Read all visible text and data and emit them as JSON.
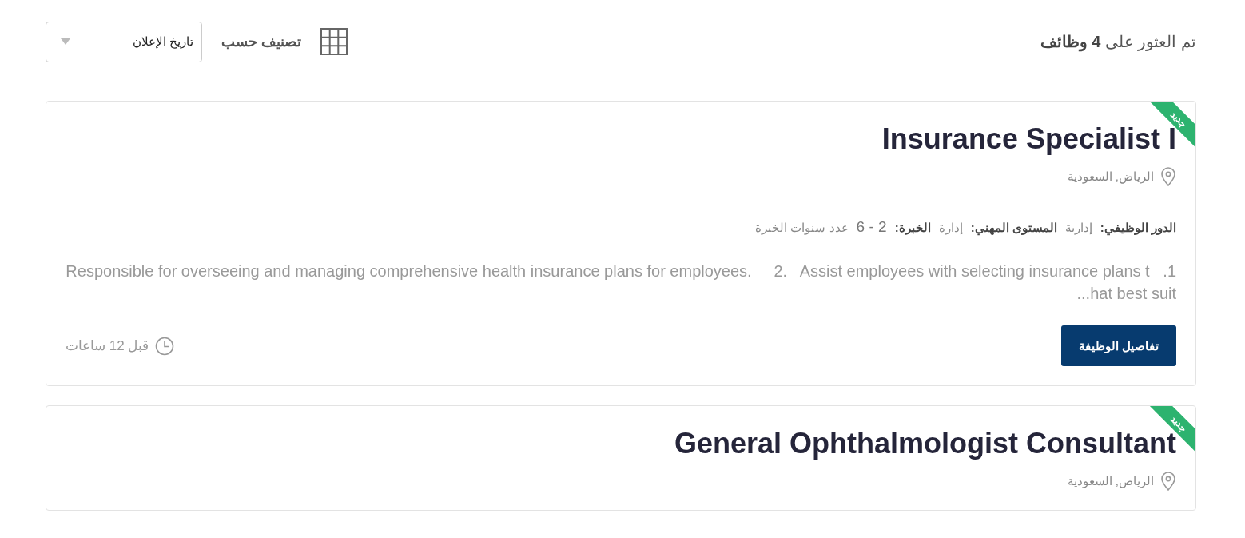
{
  "results_summary": "تم العثور على **4 وظائف**",
  "sort": {
    "label": "تصنيف حسب",
    "value": "تاريخ الإعلان"
  },
  "jobs": [
    {
      "title": "Insurance Specialist I",
      "is_new": true,
      "ribbon": "جديد",
      "location": "الرياض, السعودية",
      "meta": [
        {
          "label": "الدور الوظيفي:",
          "value": "إدارية"
        },
        {
          "label": "المستوى المهني:",
          "value": "إدارة"
        },
        {
          "label": "الخبرة:",
          "value": "2 - 6",
          "unit": "عدد سنوات الخبرة"
        }
      ],
      "description": "1.   Responsible for overseeing and managing comprehensive health insurance plans for employees.     2.   Assist employees with selecting insurance plans that best suit...",
      "button": "تفاصيل الوظيفة",
      "posted": "قبل 12 ساعات"
    },
    {
      "title": "General Ophthalmologist Consultant",
      "is_new": true,
      "ribbon": "جديد",
      "location": "الرياض, السعودية"
    }
  ]
}
